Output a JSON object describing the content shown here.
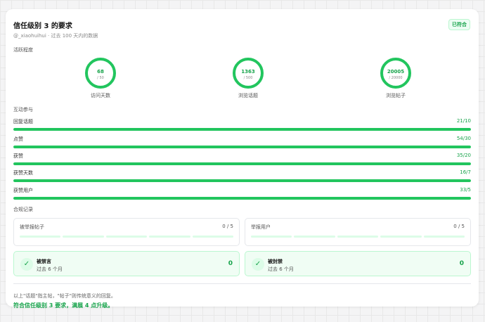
{
  "card": {
    "title": "信任级别 3 的要求",
    "badge": "已符合",
    "subtitle": "@_xiaohuihui · 过去 100 天内的数据"
  },
  "activity": {
    "label": "活跃程度",
    "rings": [
      {
        "value": "68",
        "target": "/ 50",
        "label": "访问天数"
      },
      {
        "value": "1363",
        "target": "/ 500",
        "label": "浏览话题"
      },
      {
        "value": "20005",
        "target": "/ 20000",
        "label": "浏览帖子"
      }
    ]
  },
  "interaction": {
    "label": "互动参与",
    "bars": [
      {
        "label": "回复话题",
        "value": "21/10",
        "fraction": 1.0
      },
      {
        "label": "点赞",
        "value": "54/30",
        "fraction": 1.0
      },
      {
        "label": "获赞",
        "value": "35/20",
        "fraction": 1.0
      },
      {
        "label": "获赞天数",
        "value": "16/7",
        "fraction": 1.0
      },
      {
        "label": "获赞用户",
        "value": "33/5",
        "fraction": 1.0
      }
    ]
  },
  "compliance": {
    "label": "合规记录",
    "reports": [
      {
        "label": "被举报帖子",
        "value": "0 / 5",
        "filled": 0,
        "segments": 5
      },
      {
        "label": "举报用户",
        "value": "0 / 5",
        "filled": 0,
        "segments": 5
      }
    ],
    "bans": [
      {
        "title": "被禁言",
        "sub": "过去 6 个月",
        "count": "0"
      },
      {
        "title": "被封禁",
        "sub": "过去 6 个月",
        "count": "0"
      }
    ]
  },
  "footer": {
    "note": "以上\"话题\"指主帖，\"帖子\"则传统意义的回复。",
    "conclusion": "符合信任级别 3 要求，满展 4 点升级。"
  },
  "colors": {
    "accent": "#22c55e",
    "accent_text": "#16a34a",
    "track": "#dcfce7"
  },
  "icons": {
    "check": "check-icon"
  }
}
